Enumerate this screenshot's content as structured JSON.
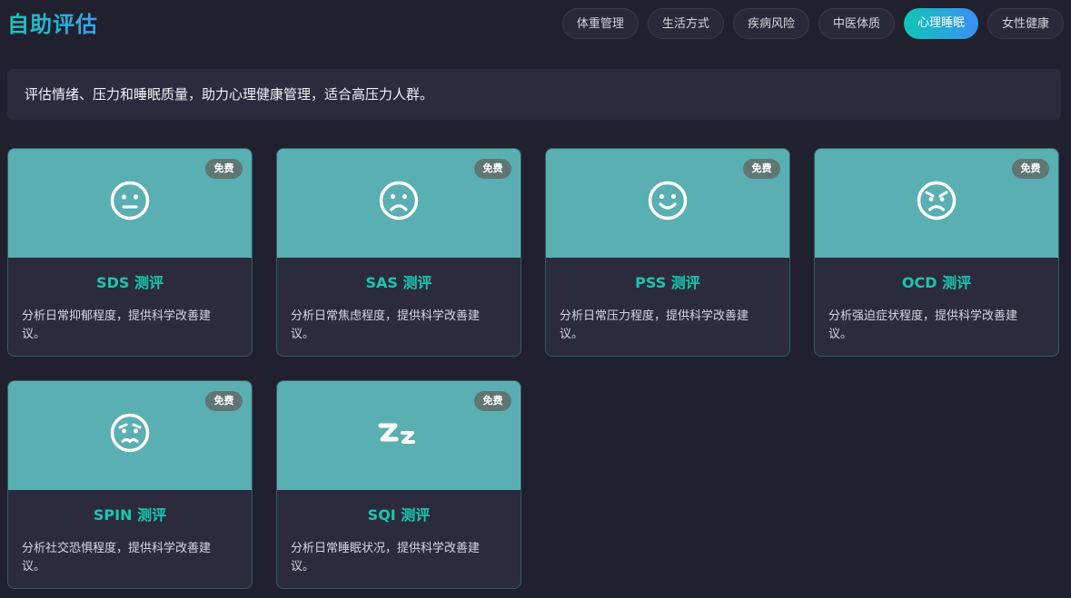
{
  "header": {
    "title": "自助评估",
    "tabs": [
      {
        "label": "体重管理",
        "active": false
      },
      {
        "label": "生活方式",
        "active": false
      },
      {
        "label": "疾病风险",
        "active": false
      },
      {
        "label": "中医体质",
        "active": false
      },
      {
        "label": "心理睡眠",
        "active": true
      },
      {
        "label": "女性健康",
        "active": false
      }
    ]
  },
  "description": "评估情绪、压力和睡眠质量，助力心理健康管理，适合高压力人群。",
  "cards": [
    {
      "badge": "免费",
      "icon": "neutral-face-icon",
      "title": "SDS 测评",
      "desc": "分析日常抑郁程度，提供科学改善建议。"
    },
    {
      "badge": "免费",
      "icon": "frowning-face-icon",
      "title": "SAS 测评",
      "desc": "分析日常焦虑程度，提供科学改善建议。"
    },
    {
      "badge": "免费",
      "icon": "smiling-face-icon",
      "title": "PSS 测评",
      "desc": "分析日常压力程度，提供科学改善建议。"
    },
    {
      "badge": "免费",
      "icon": "angry-face-icon",
      "title": "OCD 测评",
      "desc": "分析强迫症状程度，提供科学改善建议。"
    },
    {
      "badge": "免费",
      "icon": "anxious-face-icon",
      "title": "SPIN 测评",
      "desc": "分析社交恐惧程度，提供科学改善建议。"
    },
    {
      "badge": "免费",
      "icon": "sleep-zz-icon",
      "title": "SQI 测评",
      "desc": "分析日常睡眠状况，提供科学改善建议。"
    }
  ],
  "colors": {
    "background": "#21202f",
    "panel": "#2c2b3d",
    "banner": "#5aafb2",
    "accent": "#18c7ae",
    "active_tab_gradient": [
      "#10c7b5",
      "#3a8ff5"
    ],
    "badge": "#5f7673"
  }
}
